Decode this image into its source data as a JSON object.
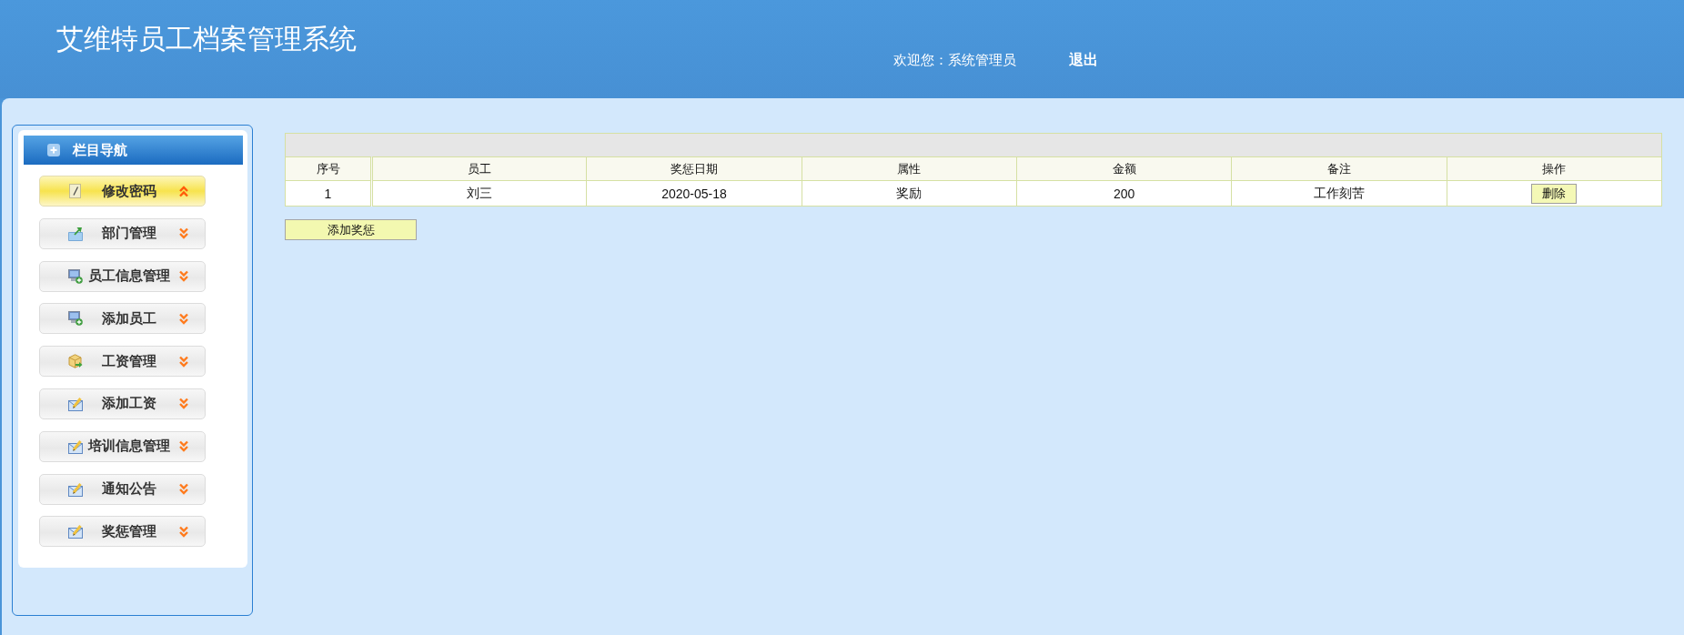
{
  "header": {
    "title": "艾维特员工档案管理系统",
    "welcome": "欢迎您：系统管理员",
    "logout": "退出"
  },
  "sidebar": {
    "title": "栏目导航",
    "items": [
      {
        "label": "修改密码",
        "selected": true
      },
      {
        "label": "部门管理",
        "selected": false
      },
      {
        "label": "员工信息管理",
        "selected": false
      },
      {
        "label": "添加员工",
        "selected": false
      },
      {
        "label": "工资管理",
        "selected": false
      },
      {
        "label": "添加工资",
        "selected": false
      },
      {
        "label": "培训信息管理",
        "selected": false
      },
      {
        "label": "通知公告",
        "selected": false
      },
      {
        "label": "奖惩管理",
        "selected": false
      }
    ]
  },
  "table": {
    "columns": [
      "序号",
      "员工",
      "奖惩日期",
      "属性",
      "金额",
      "备注",
      "操作"
    ],
    "rows": [
      {
        "cells": [
          "1",
          "刘三",
          "2020-05-18",
          "奖励",
          "200",
          "工作刻苦"
        ],
        "action": "删除"
      }
    ]
  },
  "add_button": "添加奖惩"
}
